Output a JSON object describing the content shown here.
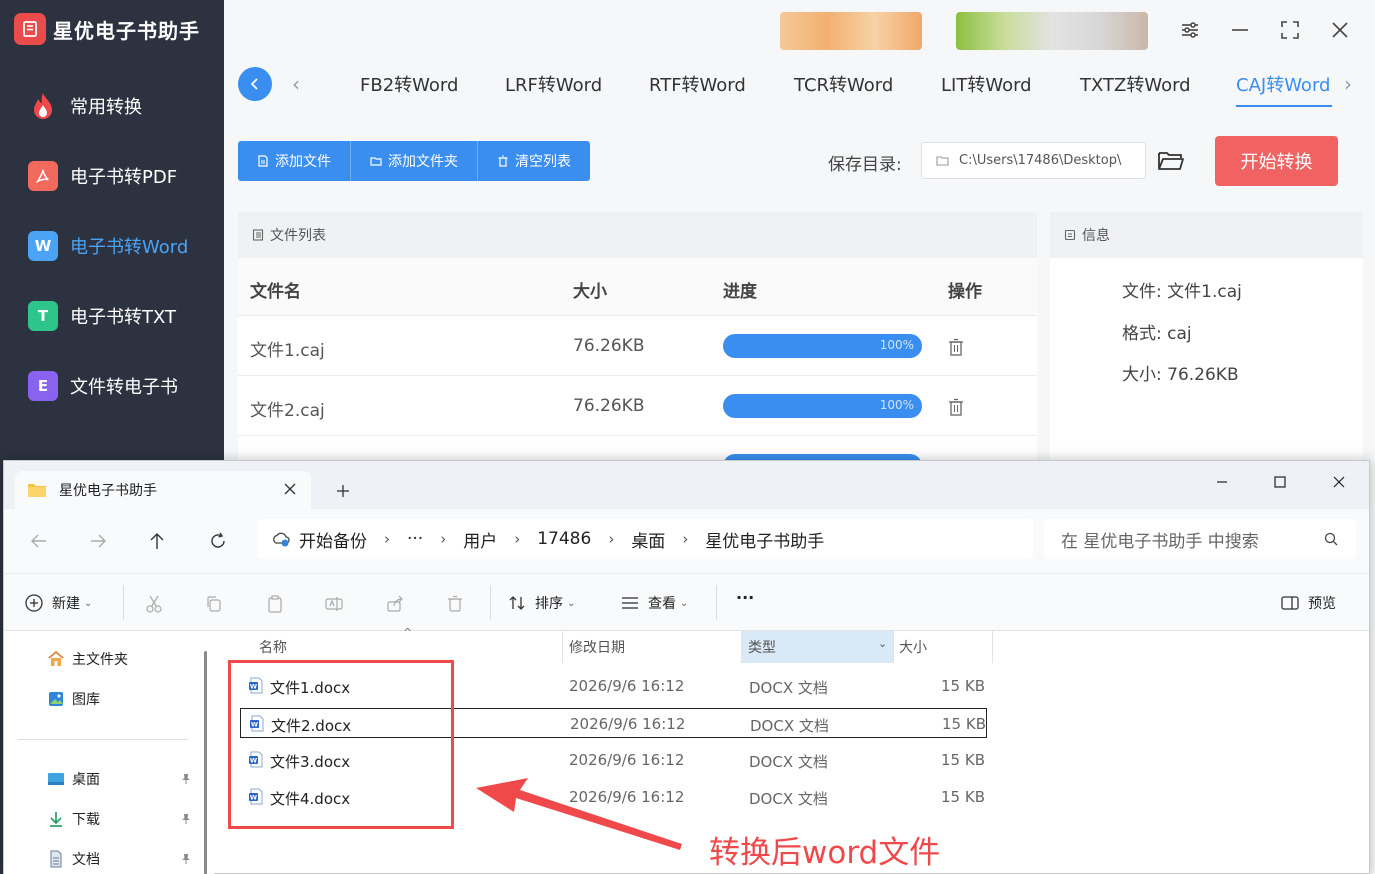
{
  "app": {
    "title": "星优电子书助手",
    "sidebar": [
      {
        "label": "常用转换",
        "icon": "fire-icon",
        "color": "#f0494c"
      },
      {
        "label": "电子书转PDF",
        "icon": "pdf-icon",
        "color": "#f26a5e"
      },
      {
        "label": "电子书转Word",
        "icon": "word-icon",
        "color": "#4aa3f5",
        "active": true
      },
      {
        "label": "电子书转TXT",
        "icon": "txt-icon",
        "color": "#2ec58a"
      },
      {
        "label": "文件转电子书",
        "icon": "ebook-icon",
        "color": "#8a62f0"
      }
    ],
    "tabs": [
      "FB2转Word",
      "LRF转Word",
      "RTF转Word",
      "TCR转Word",
      "LIT转Word",
      "TXTZ转Word",
      "CAJ转Word"
    ],
    "active_tab": "CAJ转Word",
    "toolbar": {
      "add_file": "添加文件",
      "add_folder": "添加文件夹",
      "clear_list": "清空列表"
    },
    "save_label": "保存目录:",
    "save_path": "C:\\Users\\17486\\Desktop\\",
    "start_button": "开始转换",
    "file_list": {
      "title": "文件列表",
      "columns": [
        "文件名",
        "大小",
        "进度",
        "操作"
      ],
      "rows": [
        {
          "name": "文件1.caj",
          "size": "76.26KB",
          "progress": "100%"
        },
        {
          "name": "文件2.caj",
          "size": "76.26KB",
          "progress": "100%"
        }
      ]
    },
    "info": {
      "title": "信息",
      "file_label": "文件:",
      "file_value": "文件1.caj",
      "format_label": "格式:",
      "format_value": "caj",
      "size_label": "大小:",
      "size_value": "76.26KB"
    },
    "accent": "#3a8ef0",
    "start_color": "#f16262"
  },
  "explorer": {
    "tab_title": "星优电子书助手",
    "breadcrumb": [
      "开始备份",
      "···",
      "用户",
      "17486",
      "桌面",
      "星优电子书助手"
    ],
    "search_placeholder": "在 星优电子书助手 中搜索",
    "commands": {
      "new": "新建",
      "sort": "排序",
      "view": "查看",
      "more": "···",
      "preview": "预览"
    },
    "nav": [
      {
        "label": "主文件夹",
        "icon": "home-icon"
      },
      {
        "label": "图库",
        "icon": "gallery-icon"
      },
      {
        "label": "桌面",
        "icon": "desktop-icon",
        "pinned": true
      },
      {
        "label": "下载",
        "icon": "download-icon",
        "pinned": true
      },
      {
        "label": "文档",
        "icon": "document-icon",
        "pinned": true
      }
    ],
    "columns": {
      "name": "名称",
      "date": "修改日期",
      "type": "类型",
      "size": "大小"
    },
    "files": [
      {
        "name": "文件1.docx",
        "date": "2026/9/6 16:12",
        "type": "DOCX 文档",
        "size": "15 KB"
      },
      {
        "name": "文件2.docx",
        "date": "2026/9/6 16:12",
        "type": "DOCX 文档",
        "size": "15 KB"
      },
      {
        "name": "文件3.docx",
        "date": "2026/9/6 16:12",
        "type": "DOCX 文档",
        "size": "15 KB"
      },
      {
        "name": "文件4.docx",
        "date": "2026/9/6 16:12",
        "type": "DOCX 文档",
        "size": "15 KB"
      }
    ]
  },
  "annotation": {
    "text": "转换后word文件",
    "color": "#f0494c"
  }
}
